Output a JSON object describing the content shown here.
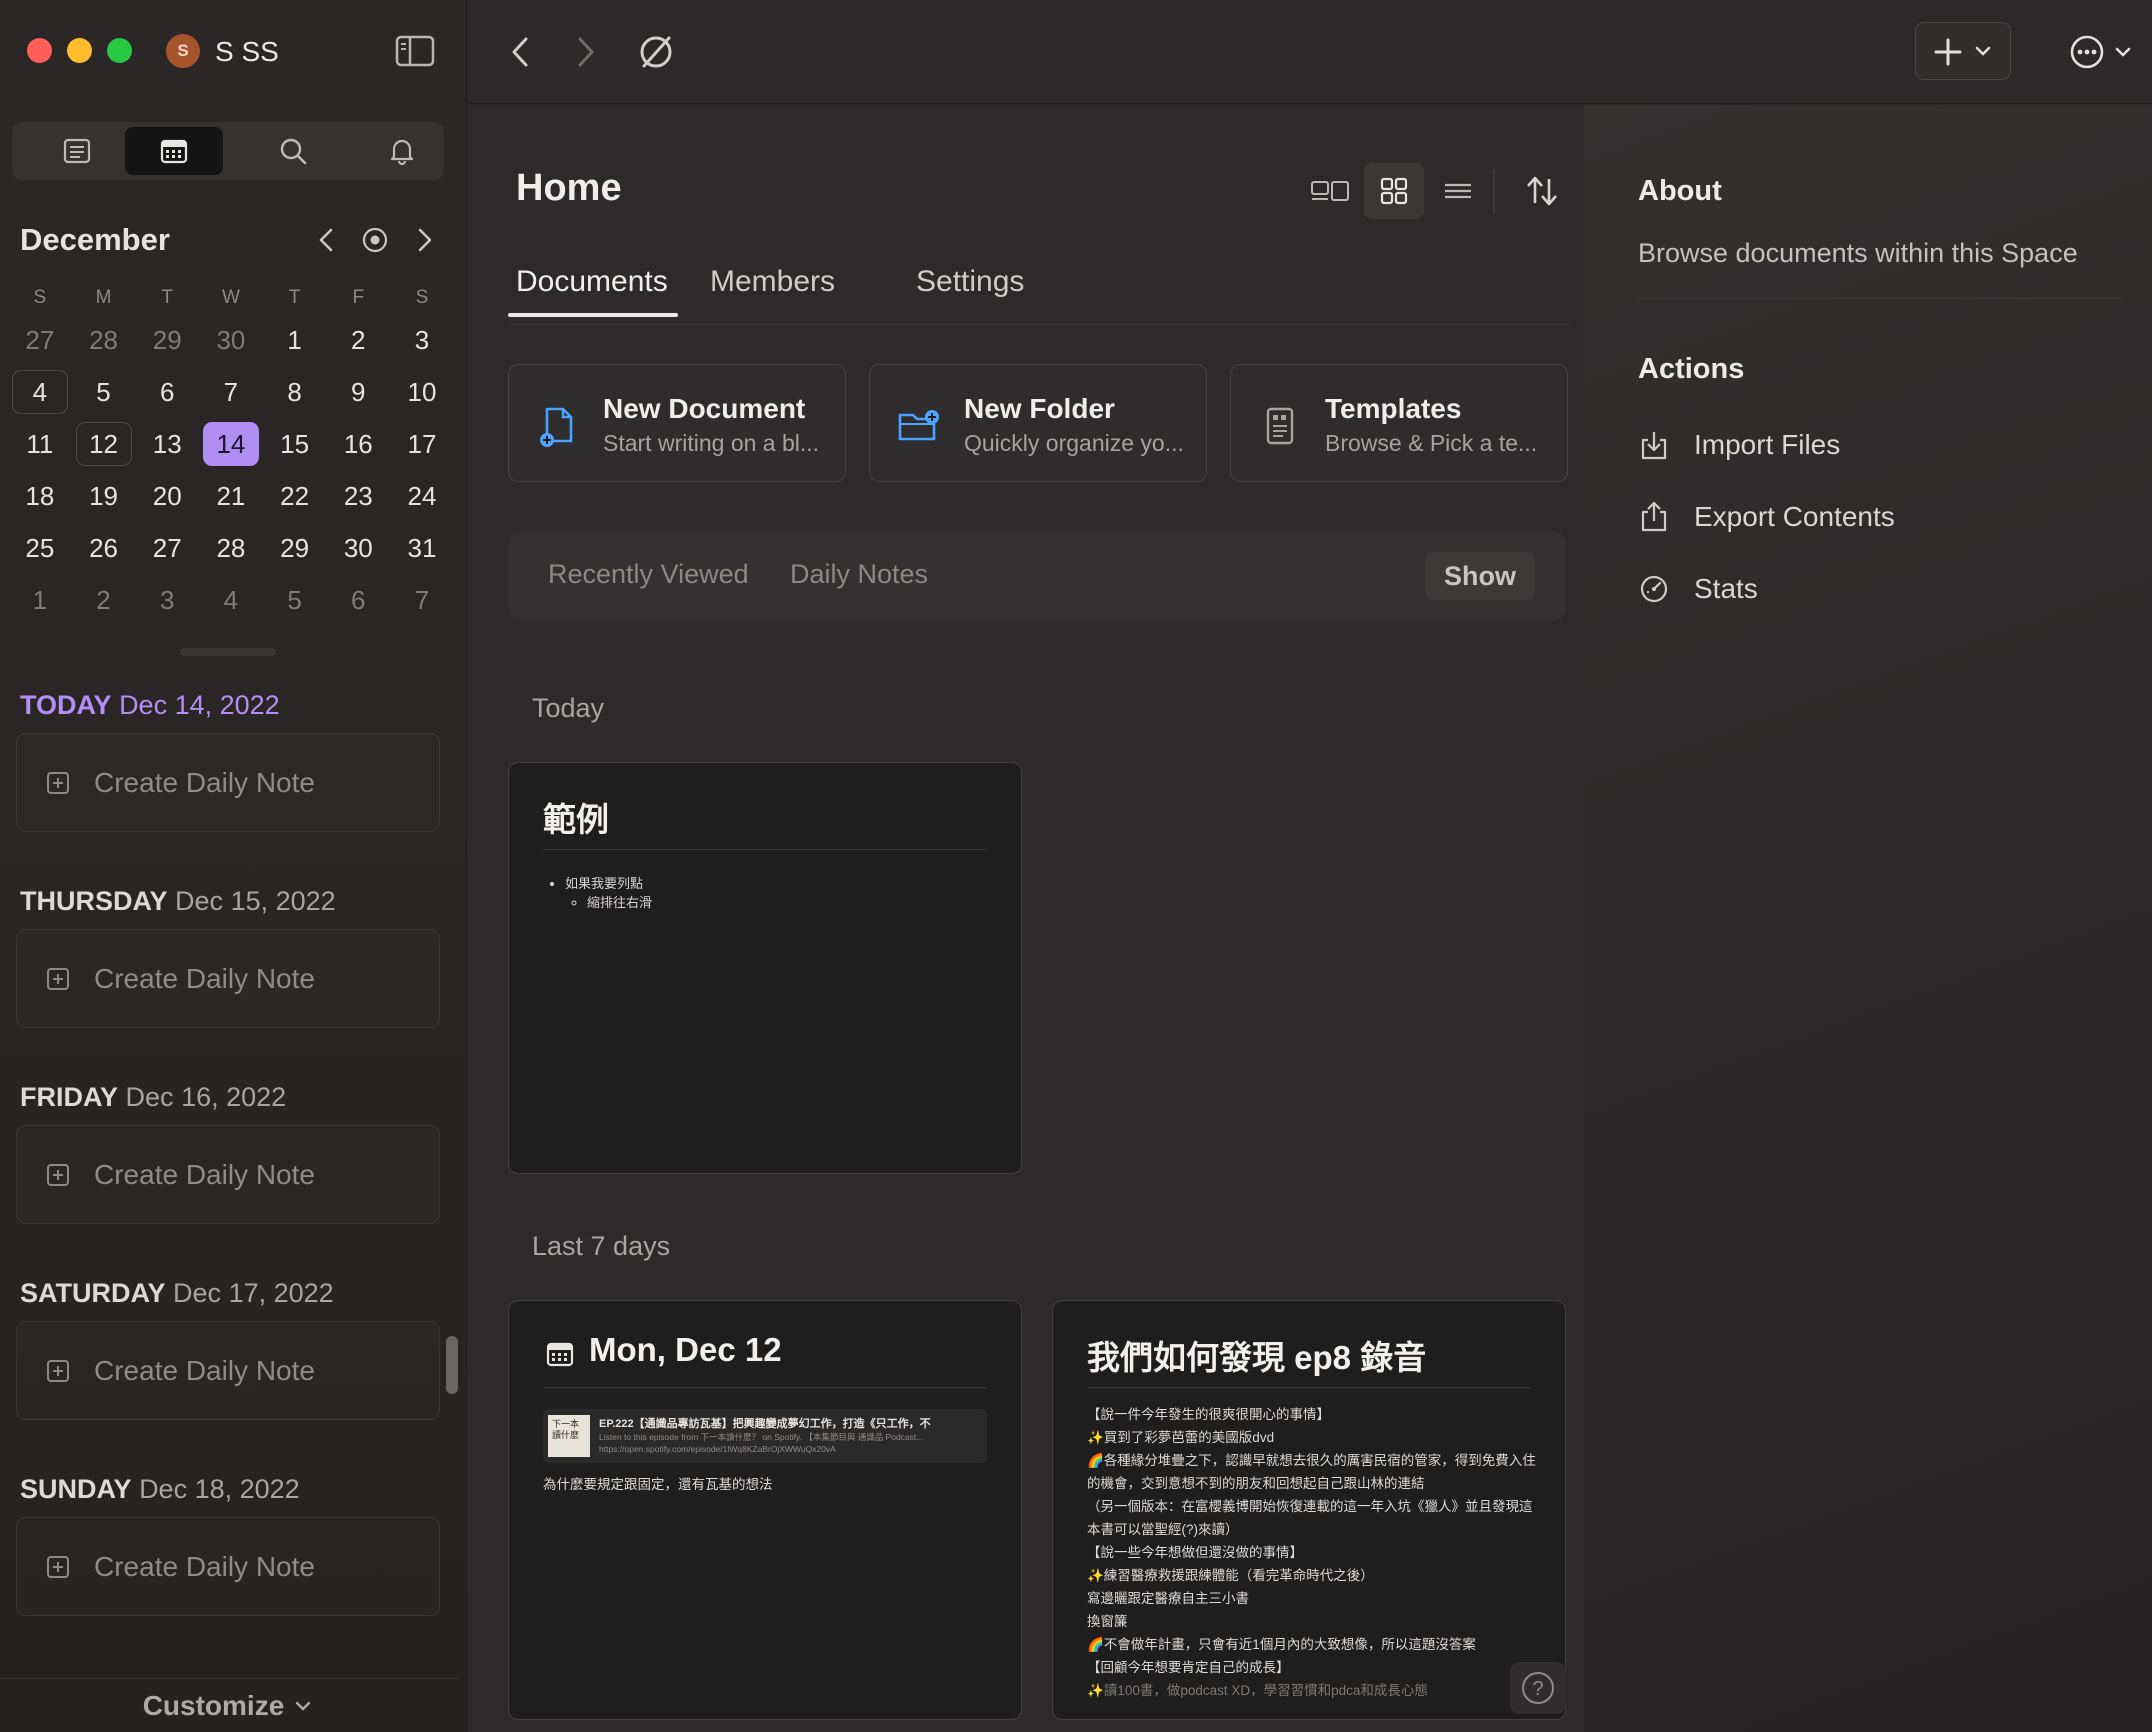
{
  "window": {
    "workspace": {
      "avatar_letter": "S",
      "name": "S SS"
    }
  },
  "sidebar": {
    "view_switch": [
      "documents-view",
      "calendar-view",
      "search",
      "notifications"
    ],
    "calendar": {
      "month": "December",
      "weekday_headers": [
        "S",
        "M",
        "T",
        "W",
        "T",
        "F",
        "S"
      ],
      "weeks": [
        [
          "27",
          "28",
          "29",
          "30",
          "1",
          "2",
          "3"
        ],
        [
          "4",
          "5",
          "6",
          "7",
          "8",
          "9",
          "10"
        ],
        [
          "11",
          "12",
          "13",
          "14",
          "15",
          "16",
          "17"
        ],
        [
          "18",
          "19",
          "20",
          "21",
          "22",
          "23",
          "24"
        ],
        [
          "25",
          "26",
          "27",
          "28",
          "29",
          "30",
          "31"
        ],
        [
          "1",
          "2",
          "3",
          "4",
          "5",
          "6",
          "7"
        ]
      ],
      "selected_day": "14"
    },
    "days": [
      {
        "weekday": "TODAY",
        "date": "Dec 14, 2022",
        "button": "Create Daily Note"
      },
      {
        "weekday": "THURSDAY",
        "date": "Dec 15, 2022",
        "button": "Create Daily Note"
      },
      {
        "weekday": "FRIDAY",
        "date": "Dec 16, 2022",
        "button": "Create Daily Note"
      },
      {
        "weekday": "SATURDAY",
        "date": "Dec 17, 2022",
        "button": "Create Daily Note"
      },
      {
        "weekday": "SUNDAY",
        "date": "Dec 18, 2022",
        "button": "Create Daily Note"
      }
    ],
    "customize_label": "Customize"
  },
  "main": {
    "title": "Home",
    "tabs": [
      "Documents",
      "Members",
      "Settings"
    ],
    "actions": [
      {
        "title": "New Document",
        "subtitle": "Start writing on a bl..."
      },
      {
        "title": "New Folder",
        "subtitle": "Quickly organize yo..."
      },
      {
        "title": "Templates",
        "subtitle": "Browse & Pick a te..."
      }
    ],
    "recent": {
      "tab1": "Recently Viewed",
      "tab2": "Daily Notes",
      "show": "Show"
    },
    "sections": {
      "today": "Today",
      "last7": "Last 7 days"
    },
    "cards": {
      "today_card": {
        "title": "範例",
        "bullet": "如果我要列點",
        "sub_bullet": "縮排往右滑"
      },
      "daily_card": {
        "title": "Mon, Dec 12",
        "embed_thumb": "下一本讀什麼",
        "embed_title": "EP.222【通識品專訪瓦基】把興趣變成夢幻工作，打造《只工作，不",
        "embed_desc": "Listen to this episode from 下一本讀什麼？ on Spotify. 【本集節目與 通識品 Podcast...",
        "embed_url": "https://open.spotify.com/episode/1lWq8KZaBrOjXWWuQx20vA",
        "text": "為什麼要規定跟固定，還有瓦基的想法"
      },
      "ep8_card": {
        "title": "我們如何發現 ep8 錄音",
        "lines": [
          "【說一件今年發生的很爽很開心的事情】",
          "✨買到了彩夢芭蕾的美國版dvd",
          "🌈各種緣分堆疊之下，認識早就想去很久的厲害民宿的管家，得到免費入住的機會，交到意想不到的朋友和回想起自己跟山林的連結",
          "（另一個版本：在富櫻義博開始恢復連載的這一年入坑《獵人》並且發現這本書可以當聖經(?)來讀）",
          "【說一些今年想做但還沒做的事情】",
          "✨練習醫療救援跟練體能（看完革命時代之後）",
          "寫邊曬跟定醫療自主三小書",
          "換窗簾",
          "🌈不會做年計畫，只會有近1個月內的大致想像，所以這題沒答案",
          "【回顧今年想要肯定自己的成長】",
          "✨讀100書，做podcast XD，學習習慣和pdca和成長心態"
        ]
      }
    }
  },
  "right_panel": {
    "about_title": "About",
    "about_desc": "Browse documents within this Space",
    "actions_title": "Actions",
    "actions": [
      "Import Files",
      "Export Contents",
      "Stats"
    ]
  },
  "colors": {
    "accent": "#b28ef2",
    "today_text": "#b48ef5",
    "bg": "#2a2828"
  }
}
